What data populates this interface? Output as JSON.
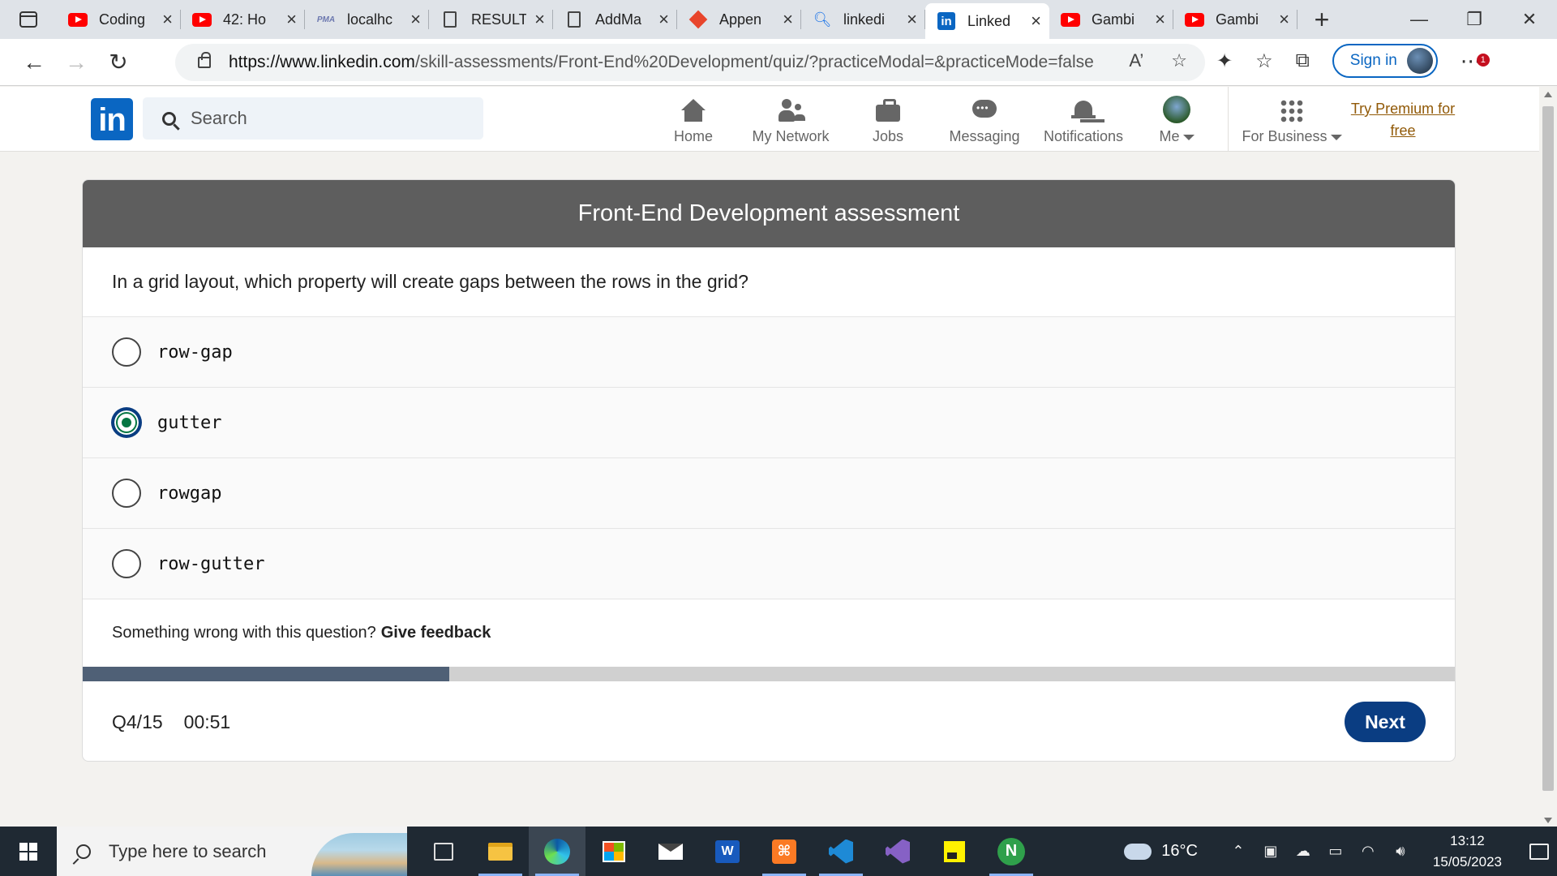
{
  "browser": {
    "tabs": [
      {
        "title": "Coding",
        "favicon": "youtube-icon"
      },
      {
        "title": "42: Ho",
        "favicon": "youtube-icon"
      },
      {
        "title": "localhc",
        "favicon": "phpmyadmin-icon",
        "favicon_text": "PMA"
      },
      {
        "title": "RESULT",
        "favicon": "document-icon"
      },
      {
        "title": "AddMa",
        "favicon": "document-icon"
      },
      {
        "title": "Appen",
        "favicon": "app-icon"
      },
      {
        "title": "linkedi",
        "favicon": "search-icon"
      },
      {
        "title": "Linked",
        "favicon": "linkedin-icon",
        "active": true
      },
      {
        "title": "Gambi",
        "favicon": "youtube-icon"
      },
      {
        "title": "Gambi",
        "favicon": "youtube-icon"
      }
    ],
    "url_host": "https://www.linkedin.com",
    "url_path": "/skill-assessments/Front-End%20Development/quiz/?practiceModal=&practiceMode=false",
    "signin_label": "Sign in",
    "notification_count": "1"
  },
  "linkedin": {
    "logo_text": "in",
    "search_placeholder": "Search",
    "nav": [
      {
        "label": "Home",
        "icon": "home-icon"
      },
      {
        "label": "My Network",
        "icon": "network-icon"
      },
      {
        "label": "Jobs",
        "icon": "briefcase-icon"
      },
      {
        "label": "Messaging",
        "icon": "message-icon"
      },
      {
        "label": "Notifications",
        "icon": "bell-icon"
      },
      {
        "label": "Me",
        "icon": "avatar-icon"
      },
      {
        "label": "For Business",
        "icon": "grid-icon"
      }
    ],
    "premium_line1": "Try Premium for",
    "premium_line2": "free",
    "accent": "#0a66c2"
  },
  "assessment": {
    "title": "Front-End Development assessment",
    "question": "In a grid layout, which property will create gaps between the rows in the grid?",
    "options": [
      {
        "text": "row-gap",
        "selected": false
      },
      {
        "text": "gutter",
        "selected": true
      },
      {
        "text": "rowgap",
        "selected": false
      },
      {
        "text": "row-gutter",
        "selected": false
      }
    ],
    "feedback_prompt": "Something wrong with this question?",
    "feedback_link": "Give feedback",
    "progress_fraction": 0.267,
    "question_counter": "Q4/15",
    "timer": "00:51",
    "next_label": "Next"
  },
  "taskbar": {
    "search_placeholder": "Type here to search",
    "temperature": "16°C",
    "time": "13:12",
    "date": "15/05/2023"
  }
}
